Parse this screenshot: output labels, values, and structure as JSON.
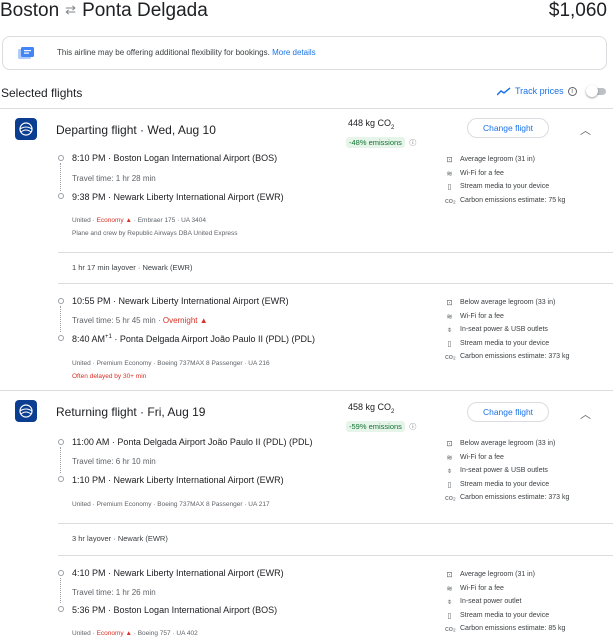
{
  "header": {
    "origin": "Boston",
    "swap_icon": "arrows-swap-icon",
    "destination": "Ponta Delgada",
    "price": "$1,060"
  },
  "banner": {
    "message": "This airline may be offering additional flexibility for bookings.",
    "link": "More details"
  },
  "selected": {
    "title": "Selected flights",
    "track_label": "Track prices",
    "toggle_on": false
  },
  "departing": {
    "title": "Departing flight",
    "date": "Wed, Aug 10",
    "co2": "448 kg CO",
    "co2_sub": "2",
    "emissions": "-48% emissions",
    "change": "Change flight",
    "legs": [
      {
        "dep_time": "8:10 PM",
        "dep_airport": "Boston Logan International Airport (BOS)",
        "travel": "Travel time: 1 hr 28 min",
        "arr_time": "9:38 PM",
        "arr_airport": "Newark Liberty International Airport (EWR)",
        "meta_airline": "United · ",
        "meta_class": "Economy",
        "meta_rest": " · Embraer 175 · UA 3404",
        "meta2": "Plane and crew by Republic Airways DBA United Express",
        "amenities": [
          "Average legroom (31 in)",
          "Wi-Fi for a fee",
          "Stream media to your device",
          "Carbon emissions estimate: 75 kg"
        ]
      },
      {
        "dep_time": "10:55 PM",
        "dep_airport": "Newark Liberty International Airport (EWR)",
        "travel": "Travel time: 5 hr 45 min · ",
        "overnight": "Overnight",
        "arr_time": "8:40 AM",
        "arr_sup": "+1",
        "arr_airport": "Ponta Delgada Airport João Paulo II (PDL) (PDL)",
        "meta": "United · Premium Economy · Boeing 737MAX 8 Passenger · UA 216",
        "delay": "Often delayed by 30+ min",
        "amenities": [
          "Below average legroom (33 in)",
          "Wi-Fi for a fee",
          "In-seat power & USB outlets",
          "Stream media to your device",
          "Carbon emissions estimate: 373 kg"
        ]
      }
    ],
    "layover": "1 hr 17 min layover · Newark (EWR)"
  },
  "returning": {
    "title": "Returning flight",
    "date": "Fri, Aug 19",
    "co2": "458 kg CO",
    "co2_sub": "2",
    "emissions": "-59% emissions",
    "change": "Change flight",
    "legs": [
      {
        "dep_time": "11:00 AM",
        "dep_airport": "Ponta Delgada Airport João Paulo II (PDL) (PDL)",
        "travel": "Travel time: 6 hr 10 min",
        "arr_time": "1:10 PM",
        "arr_airport": "Newark Liberty International Airport (EWR)",
        "meta": "United · Premium Economy · Boeing 737MAX 8 Passenger · UA 217",
        "amenities": [
          "Below average legroom (33 in)",
          "Wi-Fi for a fee",
          "In-seat power & USB outlets",
          "Stream media to your device",
          "Carbon emissions estimate: 373 kg"
        ]
      },
      {
        "dep_time": "4:10 PM",
        "dep_airport": "Newark Liberty International Airport (EWR)",
        "travel": "Travel time: 1 hr 26 min",
        "arr_time": "5:36 PM",
        "arr_airport": "Boston Logan International Airport (BOS)",
        "meta_airline": "United · ",
        "meta_class": "Economy",
        "meta_rest": " · Boeing 757 · UA 402",
        "amenities": [
          "Average legroom (31 in)",
          "Wi-Fi for a fee",
          "In-seat power outlet",
          "Stream media to your device",
          "Carbon emissions estimate: 85 kg"
        ]
      }
    ],
    "layover": "3 hr layover · Newark (EWR)"
  }
}
